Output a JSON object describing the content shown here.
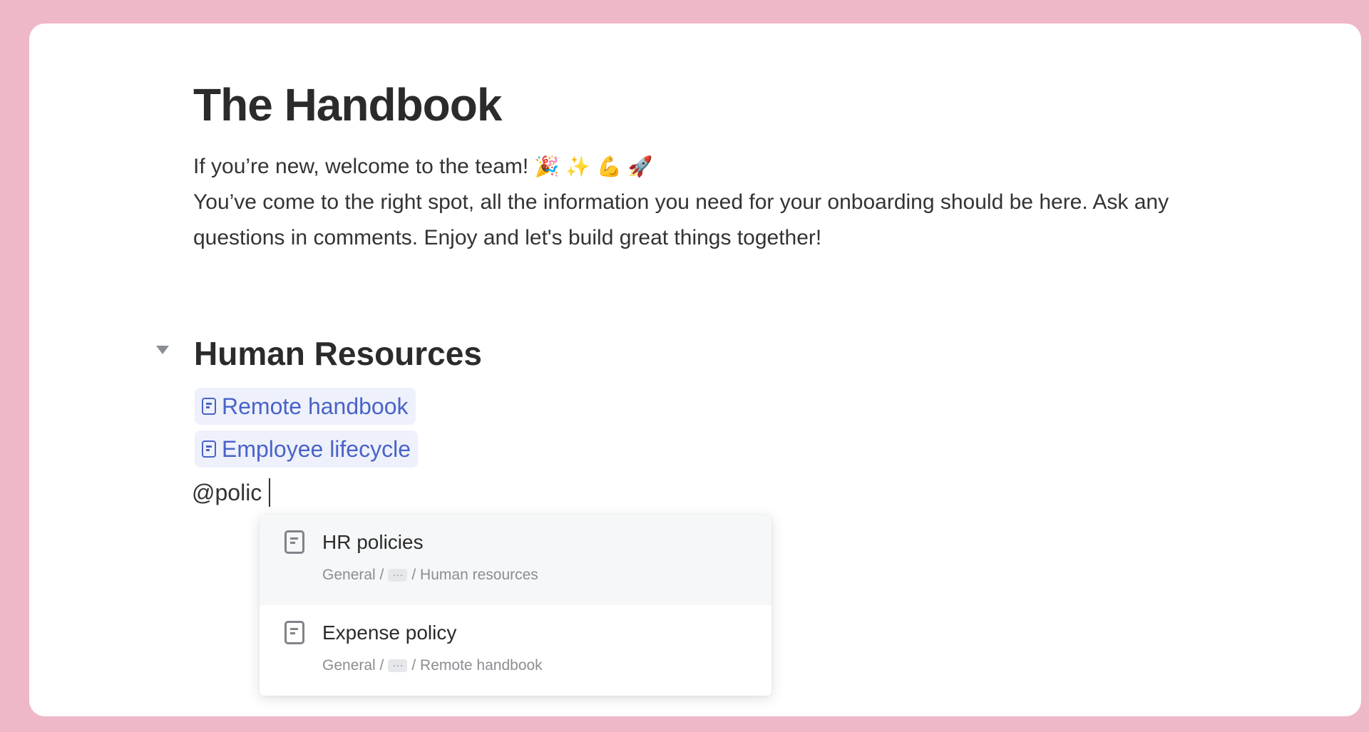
{
  "document": {
    "title": "The Handbook",
    "intro_line1_text": "If you’re new, welcome to the team!",
    "intro_line1_emojis": "🎉 ✨ 💪 🚀",
    "intro_line2": "You’ve come to the right spot, all the information you need for your onboarding should be here. Ask any questions in comments. Enjoy and let's build great things together!"
  },
  "section": {
    "title": "Human Resources",
    "links": [
      {
        "label": "Remote handbook"
      },
      {
        "label": "Employee lifecycle"
      }
    ]
  },
  "mention": {
    "typed_text": "@polic"
  },
  "suggestions": [
    {
      "title": "HR policies",
      "path_start": "General /",
      "path_ellipsis": "···",
      "path_end": "/ Human resources",
      "highlighted": true
    },
    {
      "title": "Expense policy",
      "path_start": "General /",
      "path_ellipsis": "···",
      "path_end": "/ Remote handbook",
      "highlighted": false
    }
  ],
  "icons": {
    "toggle": "caret-down-icon",
    "page": "document-icon"
  },
  "colors": {
    "background": "#efb8c8",
    "link": "#4a63c8",
    "link_background": "#eef1fb"
  }
}
